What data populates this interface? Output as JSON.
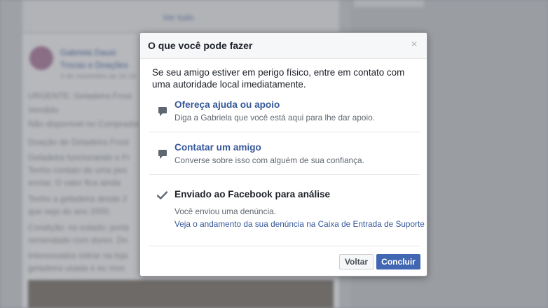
{
  "background": {
    "see_all": "Ver tudo",
    "post_author": "Gabriela Dausi",
    "post_group": "Trocas e Doações",
    "post_meta": "4 de novembro às 16:19",
    "lines": [
      "URGENTE: Geladeira Frost",
      "Vendido",
      "Não disponível no Comprador",
      "Doação de Geladeira Frost",
      "Geladeira funcionando e Fr",
      "Tenho contato de uma pes",
      "enviar. O valor fica ainda",
      "Tenho a geladeira desde 2",
      "que seja do ano 2000.",
      "Condição: no estado: porta",
      "remendado com durex. Do",
      "Interessados retirar na loja",
      "geladeira usada e eu mov"
    ]
  },
  "modal": {
    "title": "O que você pode fazer",
    "close_symbol": "×",
    "intro": "Se seu amigo estiver em perigo físico, entre em contato com uma autoridade local imediatamente.",
    "options": [
      {
        "icon": "chat-bubble-icon",
        "title": "Ofereça ajuda ou apoio",
        "description": "Diga a Gabriela que você está aqui para lhe dar apoio."
      },
      {
        "icon": "chat-bubble-icon",
        "title": "Contatar um amigo",
        "description": "Converse sobre isso com alguém de sua confiança."
      }
    ],
    "sent": {
      "icon": "checkmark-icon",
      "title": "Enviado ao Facebook para análise",
      "description": "Você enviou uma denúncia.",
      "link": "Veja o andamento da sua denúncia na Caixa de Entrada de Suporte"
    },
    "buttons": {
      "back": "Voltar",
      "done": "Concluir"
    }
  },
  "colors": {
    "link": "#365899",
    "primary_button": "#4267b2",
    "overlay": "#8e9197"
  }
}
